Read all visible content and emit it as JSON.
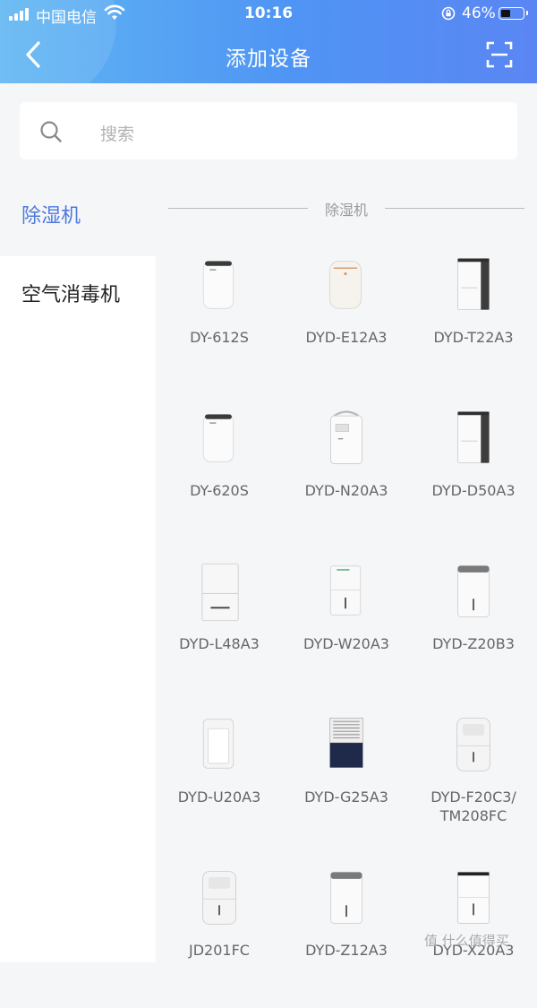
{
  "status_bar": {
    "carrier": "中国电信",
    "time": "10:16",
    "battery_percent": "46%",
    "battery_level": 0.46
  },
  "header": {
    "title": "添加设备",
    "back_icon": "chevron-left-icon",
    "scan_icon": "scan-icon"
  },
  "search": {
    "placeholder": "搜索"
  },
  "sidebar": {
    "items": [
      {
        "label": "除湿机",
        "active": true
      },
      {
        "label": "空气消毒机",
        "active": false
      }
    ]
  },
  "section": {
    "title": "除湿机"
  },
  "devices": [
    {
      "model": "DY-612S",
      "style": "round-white"
    },
    {
      "model": "DYD-E12A3",
      "style": "round-cream"
    },
    {
      "model": "DYD-T22A3",
      "style": "tall-dark-side"
    },
    {
      "model": "DY-620S",
      "style": "round-white"
    },
    {
      "model": "DYD-N20A3",
      "style": "handle-white"
    },
    {
      "model": "DYD-D50A3",
      "style": "tall-dark-side"
    },
    {
      "model": "DYD-L48A3",
      "style": "box-white"
    },
    {
      "model": "DYD-W20A3",
      "style": "box-white-green"
    },
    {
      "model": "DYD-Z20B3",
      "style": "grey-top"
    },
    {
      "model": "DYD-U20A3",
      "style": "frame-white"
    },
    {
      "model": "DYD-G25A3",
      "style": "navy-grille"
    },
    {
      "model": "DYD-F20C3/ TM208FC",
      "style": "rounded-grey"
    },
    {
      "model": "JD201FC",
      "style": "rounded-grey"
    },
    {
      "model": "DYD-Z12A3",
      "style": "grey-top"
    },
    {
      "model": "DYD-X20A3",
      "style": "black-top"
    }
  ],
  "watermark": "值 什么值得买"
}
